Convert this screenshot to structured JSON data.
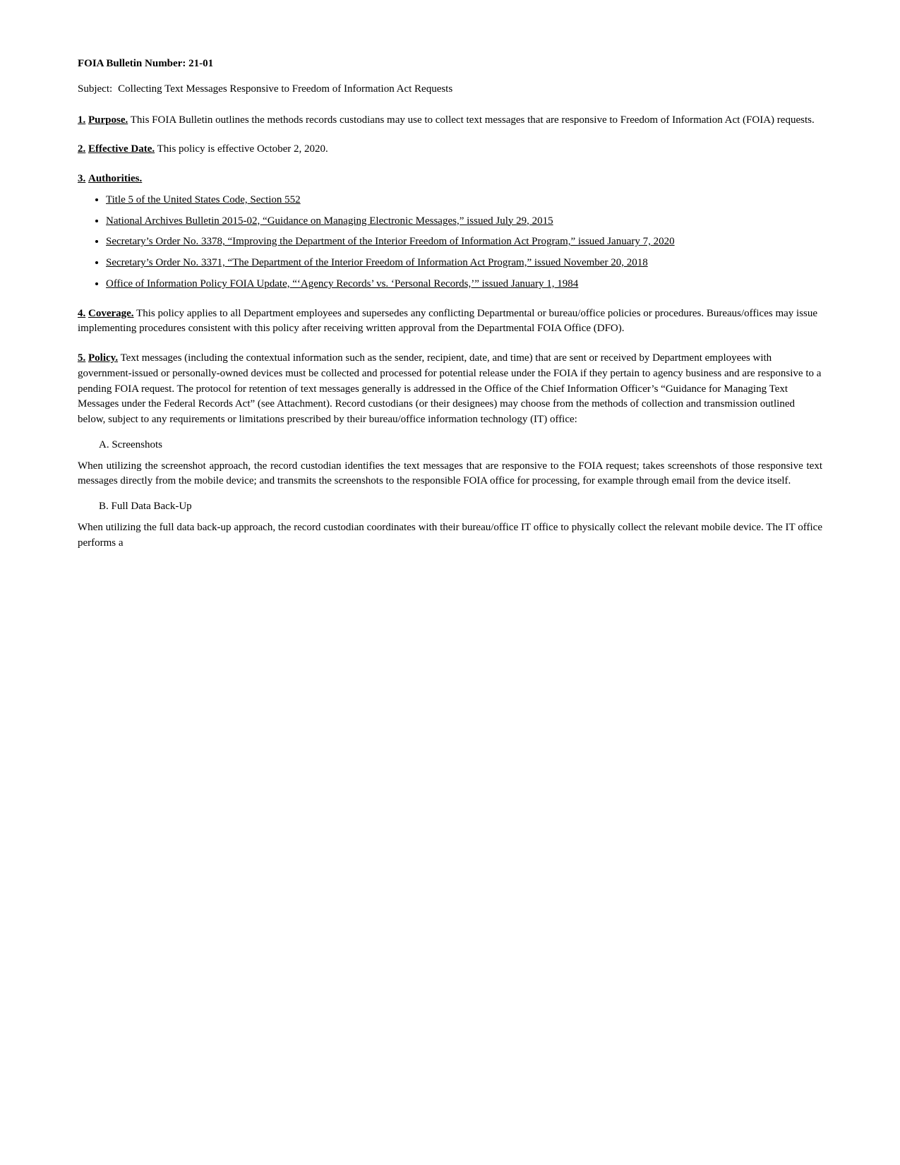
{
  "bulletin": {
    "number_label": "FOIA Bulletin Number:  21-01",
    "subject_label": "Subject:",
    "subject_text": "Collecting Text Messages Responsive to Freedom of Information Act Requests"
  },
  "sections": [
    {
      "id": "purpose",
      "heading_num": "1.",
      "heading_title": "Purpose.",
      "body": "This FOIA Bulletin outlines the methods records custodians may use to collect text messages that are responsive to Freedom of Information Act (FOIA) requests."
    },
    {
      "id": "effective-date",
      "heading_num": "2.",
      "heading_title": "Effective Date.",
      "body": "This policy is effective October 2, 2020."
    },
    {
      "id": "authorities",
      "heading_num": "3.",
      "heading_title": "Authorities.",
      "bullets": [
        "Title 5 of the United States Code, Section 552",
        "National Archives Bulletin 2015-02, “Guidance on Managing Electronic Messages,” issued July 29, 2015",
        "Secretary’s Order No. 3378, “Improving the Department of the Interior Freedom of Information Act Program,” issued January 7, 2020",
        "Secretary’s Order No. 3371, “The Department of the Interior Freedom of Information Act Program,” issued November 20, 2018",
        "Office of Information Policy FOIA Update, “‘Agency Records’ vs. ‘Personal Records,’” issued January 1, 1984"
      ]
    },
    {
      "id": "coverage",
      "heading_num": "4.",
      "heading_title": "Coverage.",
      "body": "This policy applies to all Department employees and supersedes any conflicting Departmental or bureau/office policies or procedures.  Bureaus/offices may issue implementing procedures consistent with this policy after receiving written approval from the Departmental FOIA Office (DFO)."
    },
    {
      "id": "policy",
      "heading_num": "5.",
      "heading_title": "Policy.",
      "body": "Text messages (including the contextual information such as the sender, recipient, date, and time) that are sent or received by Department employees with government-issued or personally-owned devices must be collected and processed for potential release under the FOIA if they pertain to agency business and are responsive to a pending FOIA request.  The protocol for retention of text messages generally is addressed in the Office of the Chief Information Officer’s “Guidance for Managing Text Messages under the Federal Records Act” (see Attachment).  Record custodians (or their designees) may choose from the methods of collection and transmission outlined below, subject to any requirements or limitations prescribed by their bureau/office information technology (IT) office:",
      "subsections": [
        {
          "label": "A.  Screenshots",
          "body": "When utilizing the screenshot approach, the record custodian identifies the text messages that are responsive to the FOIA request; takes screenshots of those responsive text messages directly from the mobile device; and transmits the screenshots to the responsible FOIA office for processing, for example through email from the device itself."
        },
        {
          "label": "B.  Full Data Back-Up",
          "body": "When utilizing the full data back-up approach, the record custodian coordinates with their bureau/office IT office to physically collect the relevant mobile device.  The IT office performs a"
        }
      ]
    }
  ]
}
